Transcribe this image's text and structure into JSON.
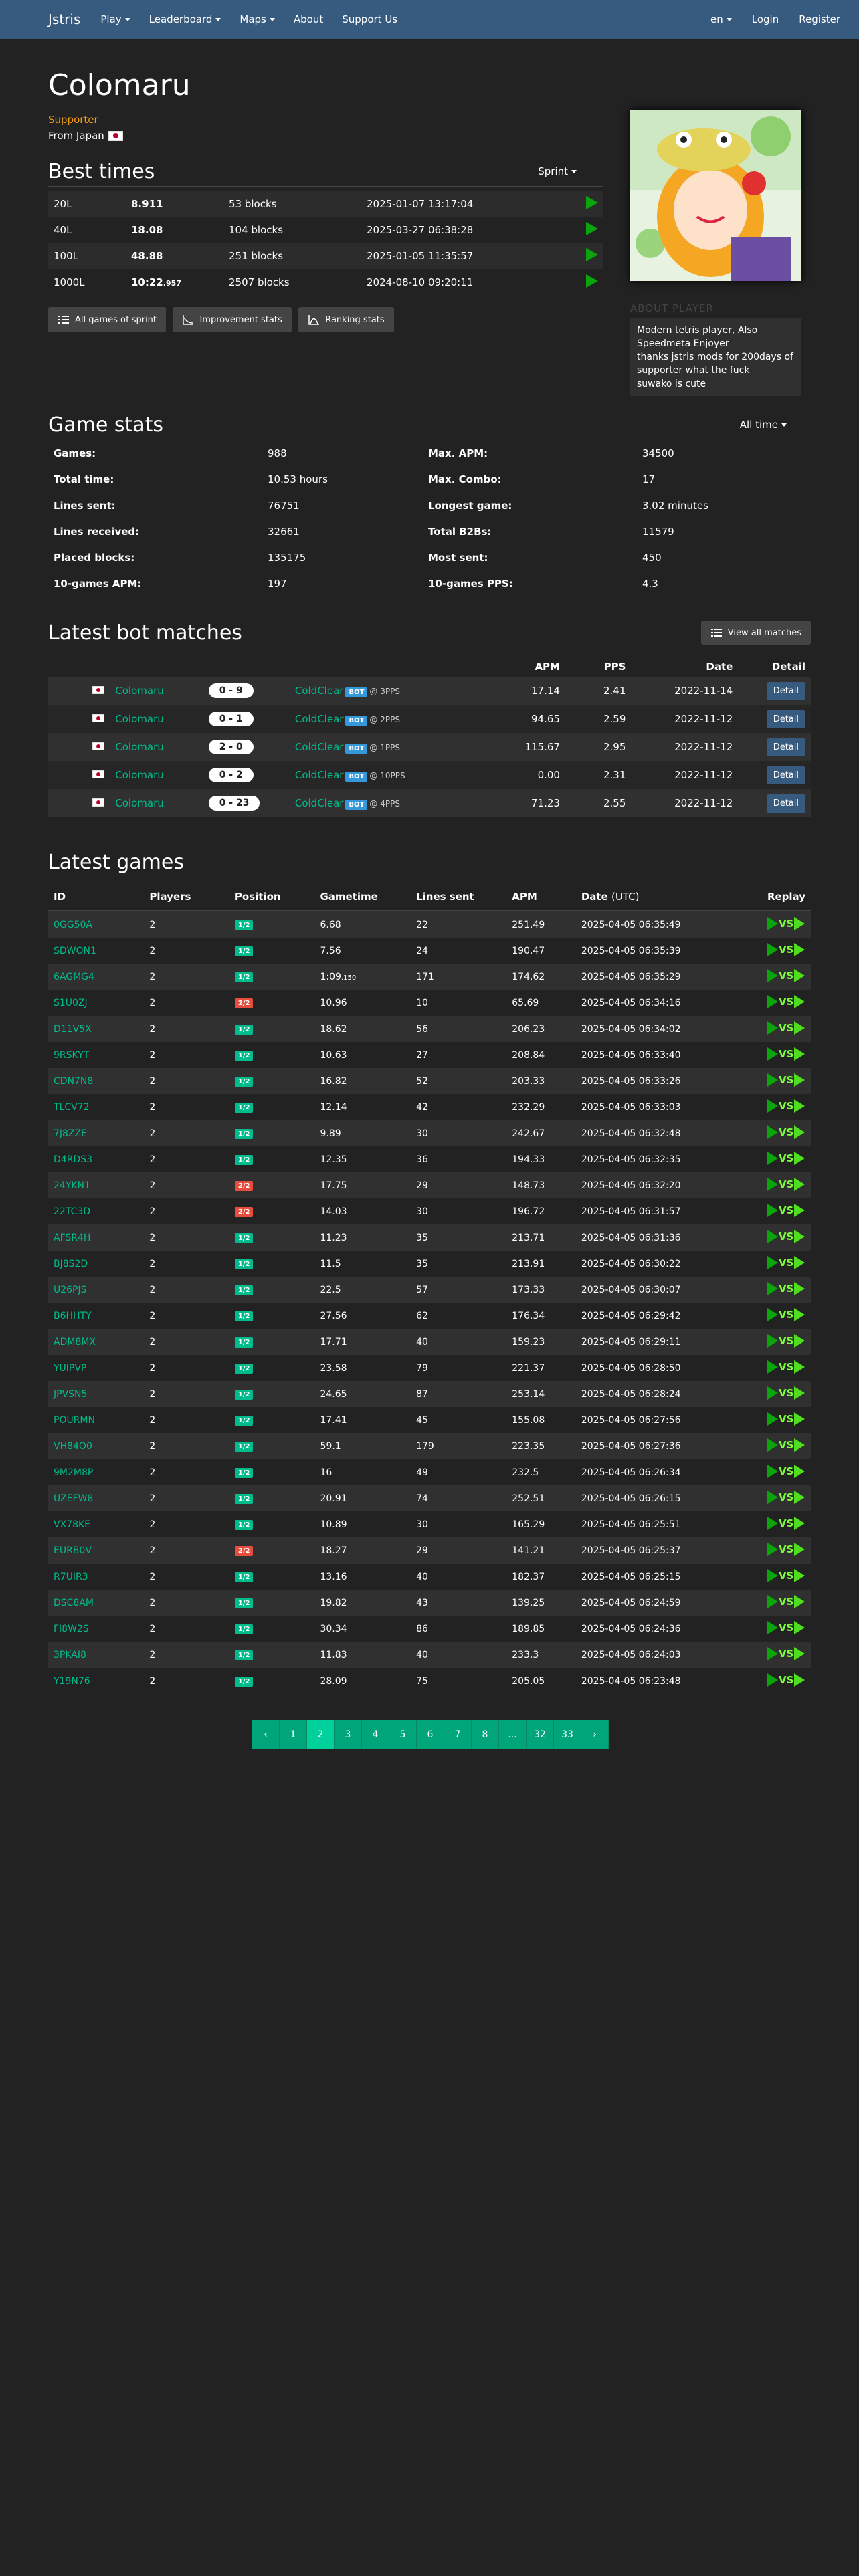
{
  "navbar": {
    "brand": "Jstris",
    "items": [
      "Play",
      "Leaderboard",
      "Maps",
      "About",
      "Support Us"
    ],
    "lang": "en",
    "login": "Login",
    "register": "Register"
  },
  "profile": {
    "username": "Colomaru",
    "role": "Supporter",
    "from": "From Japan",
    "about_label": "ABOUT PLAYER",
    "about_lines": [
      "Modern tetris player, Also Speedmeta Enjoyer",
      "thanks jstris mods for 200days of supporter what the fuck",
      "suwako is cute"
    ]
  },
  "best_times": {
    "title": "Best times",
    "dropdown": "Sprint",
    "rows": [
      {
        "mode": "20L",
        "time": "8.911",
        "blocks": "53 blocks",
        "date": "2025-01-07 13:17:04"
      },
      {
        "mode": "40L",
        "time": "18.08",
        "blocks": "104 blocks",
        "date": "2025-03-27 06:38:28"
      },
      {
        "mode": "100L",
        "time": "48.88",
        "blocks": "251 blocks",
        "date": "2025-01-05 11:35:57"
      },
      {
        "mode": "1000L",
        "time": "10:22",
        "time_ms": ".957",
        "blocks": "2507 blocks",
        "date": "2024-08-10 09:20:11"
      }
    ],
    "buttons": [
      "All games of sprint",
      "Improvement stats",
      "Ranking stats"
    ]
  },
  "game_stats": {
    "title": "Game stats",
    "dropdown": "All time",
    "rows": [
      [
        "Games:",
        "988",
        "Max. APM:",
        "34500"
      ],
      [
        "Total time:",
        "10.53 hours",
        "Max. Combo:",
        "17"
      ],
      [
        "Lines sent:",
        "76751",
        "Longest game:",
        "3.02 minutes"
      ],
      [
        "Lines received:",
        "32661",
        "Total B2Bs:",
        "11579"
      ],
      [
        "Placed blocks:",
        "135175",
        "Most sent:",
        "450"
      ],
      [
        "10-games APM:",
        "197",
        "10-games PPS:",
        "4.3"
      ]
    ]
  },
  "bot_matches": {
    "title": "Latest bot matches",
    "view_all": "View all matches",
    "headers": [
      "APM",
      "PPS",
      "Date",
      "Detail"
    ],
    "bot_badge": "BOT",
    "detail_label": "Detail",
    "rows": [
      {
        "player": "Colomaru",
        "score": "0 - 9",
        "bot": "ColdClear",
        "pps_setting": "@ 3PPS",
        "apm": "17.14",
        "pps": "2.41",
        "date": "2022-11-14"
      },
      {
        "player": "Colomaru",
        "score": "0 - 1",
        "bot": "ColdClear",
        "pps_setting": "@ 2PPS",
        "apm": "94.65",
        "pps": "2.59",
        "date": "2022-11-12"
      },
      {
        "player": "Colomaru",
        "score": "2 - 0",
        "bot": "ColdClear",
        "pps_setting": "@ 1PPS",
        "apm": "115.67",
        "pps": "2.95",
        "date": "2022-11-12"
      },
      {
        "player": "Colomaru",
        "score": "0 - 2",
        "bot": "ColdClear",
        "pps_setting": "@ 10PPS",
        "apm": "0.00",
        "pps": "2.31",
        "date": "2022-11-12"
      },
      {
        "player": "Colomaru",
        "score": "0 - 23",
        "bot": "ColdClear",
        "pps_setting": "@ 4PPS",
        "apm": "71.23",
        "pps": "2.55",
        "date": "2022-11-12"
      }
    ]
  },
  "latest_games": {
    "title": "Latest games",
    "headers": [
      "ID",
      "Players",
      "Position",
      "Gametime",
      "Lines sent",
      "APM",
      "Date",
      "(UTC)",
      "Replay"
    ],
    "rows": [
      {
        "id": "0GG50A",
        "players": "2",
        "pos": "1/2",
        "win": true,
        "time": "6.68",
        "lines": "22",
        "apm": "251.49",
        "date": "2025-04-05 06:35:49"
      },
      {
        "id": "SDWON1",
        "players": "2",
        "pos": "1/2",
        "win": true,
        "time": "7.56",
        "lines": "24",
        "apm": "190.47",
        "date": "2025-04-05 06:35:39"
      },
      {
        "id": "6AGMG4",
        "players": "2",
        "pos": "1/2",
        "win": true,
        "time": "1:09",
        "time_ms": ".150",
        "lines": "171",
        "apm": "174.62",
        "date": "2025-04-05 06:35:29"
      },
      {
        "id": "S1U0ZJ",
        "players": "2",
        "pos": "2/2",
        "win": false,
        "time": "10.96",
        "lines": "10",
        "apm": "65.69",
        "date": "2025-04-05 06:34:16"
      },
      {
        "id": "D11V5X",
        "players": "2",
        "pos": "1/2",
        "win": true,
        "time": "18.62",
        "lines": "56",
        "apm": "206.23",
        "date": "2025-04-05 06:34:02"
      },
      {
        "id": "9RSKYT",
        "players": "2",
        "pos": "1/2",
        "win": true,
        "time": "10.63",
        "lines": "27",
        "apm": "208.84",
        "date": "2025-04-05 06:33:40"
      },
      {
        "id": "CDN7N8",
        "players": "2",
        "pos": "1/2",
        "win": true,
        "time": "16.82",
        "lines": "52",
        "apm": "203.33",
        "date": "2025-04-05 06:33:26"
      },
      {
        "id": "TLCV72",
        "players": "2",
        "pos": "1/2",
        "win": true,
        "time": "12.14",
        "lines": "42",
        "apm": "232.29",
        "date": "2025-04-05 06:33:03"
      },
      {
        "id": "7J8ZZE",
        "players": "2",
        "pos": "1/2",
        "win": true,
        "time": "9.89",
        "lines": "30",
        "apm": "242.67",
        "date": "2025-04-05 06:32:48"
      },
      {
        "id": "D4RDS3",
        "players": "2",
        "pos": "1/2",
        "win": true,
        "time": "12.35",
        "lines": "36",
        "apm": "194.33",
        "date": "2025-04-05 06:32:35"
      },
      {
        "id": "24YKN1",
        "players": "2",
        "pos": "2/2",
        "win": false,
        "time": "17.75",
        "lines": "29",
        "apm": "148.73",
        "date": "2025-04-05 06:32:20"
      },
      {
        "id": "22TC3D",
        "players": "2",
        "pos": "2/2",
        "win": false,
        "time": "14.03",
        "lines": "30",
        "apm": "196.72",
        "date": "2025-04-05 06:31:57"
      },
      {
        "id": "AFSR4H",
        "players": "2",
        "pos": "1/2",
        "win": true,
        "time": "11.23",
        "lines": "35",
        "apm": "213.71",
        "date": "2025-04-05 06:31:36"
      },
      {
        "id": "BJ8S2D",
        "players": "2",
        "pos": "1/2",
        "win": true,
        "time": "11.5",
        "lines": "35",
        "apm": "213.91",
        "date": "2025-04-05 06:30:22"
      },
      {
        "id": "U26PJS",
        "players": "2",
        "pos": "1/2",
        "win": true,
        "time": "22.5",
        "lines": "57",
        "apm": "173.33",
        "date": "2025-04-05 06:30:07"
      },
      {
        "id": "B6HHTY",
        "players": "2",
        "pos": "1/2",
        "win": true,
        "time": "27.56",
        "lines": "62",
        "apm": "176.34",
        "date": "2025-04-05 06:29:42"
      },
      {
        "id": "ADM8MX",
        "players": "2",
        "pos": "1/2",
        "win": true,
        "time": "17.71",
        "lines": "40",
        "apm": "159.23",
        "date": "2025-04-05 06:29:11"
      },
      {
        "id": "YUIPVP",
        "players": "2",
        "pos": "1/2",
        "win": true,
        "time": "23.58",
        "lines": "79",
        "apm": "221.37",
        "date": "2025-04-05 06:28:50"
      },
      {
        "id": "JPVSN5",
        "players": "2",
        "pos": "1/2",
        "win": true,
        "time": "24.65",
        "lines": "87",
        "apm": "253.14",
        "date": "2025-04-05 06:28:24"
      },
      {
        "id": "POURMN",
        "players": "2",
        "pos": "1/2",
        "win": true,
        "time": "17.41",
        "lines": "45",
        "apm": "155.08",
        "date": "2025-04-05 06:27:56"
      },
      {
        "id": "VH84O0",
        "players": "2",
        "pos": "1/2",
        "win": true,
        "time": "59.1",
        "lines": "179",
        "apm": "223.35",
        "date": "2025-04-05 06:27:36"
      },
      {
        "id": "9M2M8P",
        "players": "2",
        "pos": "1/2",
        "win": true,
        "time": "16",
        "lines": "49",
        "apm": "232.5",
        "date": "2025-04-05 06:26:34"
      },
      {
        "id": "UZEFW8",
        "players": "2",
        "pos": "1/2",
        "win": true,
        "time": "20.91",
        "lines": "74",
        "apm": "252.51",
        "date": "2025-04-05 06:26:15"
      },
      {
        "id": "VX78KE",
        "players": "2",
        "pos": "1/2",
        "win": true,
        "time": "10.89",
        "lines": "30",
        "apm": "165.29",
        "date": "2025-04-05 06:25:51"
      },
      {
        "id": "EURB0V",
        "players": "2",
        "pos": "2/2",
        "win": false,
        "time": "18.27",
        "lines": "29",
        "apm": "141.21",
        "date": "2025-04-05 06:25:37"
      },
      {
        "id": "R7UIR3",
        "players": "2",
        "pos": "1/2",
        "win": true,
        "time": "13.16",
        "lines": "40",
        "apm": "182.37",
        "date": "2025-04-05 06:25:15"
      },
      {
        "id": "DSC8AM",
        "players": "2",
        "pos": "1/2",
        "win": true,
        "time": "19.82",
        "lines": "43",
        "apm": "139.25",
        "date": "2025-04-05 06:24:59"
      },
      {
        "id": "FI8W2S",
        "players": "2",
        "pos": "1/2",
        "win": true,
        "time": "30.34",
        "lines": "86",
        "apm": "189.85",
        "date": "2025-04-05 06:24:36"
      },
      {
        "id": "3PKAI8",
        "players": "2",
        "pos": "1/2",
        "win": true,
        "time": "11.83",
        "lines": "40",
        "apm": "233.3",
        "date": "2025-04-05 06:24:03"
      },
      {
        "id": "Y19N76",
        "players": "2",
        "pos": "1/2",
        "win": true,
        "time": "28.09",
        "lines": "75",
        "apm": "205.05",
        "date": "2025-04-05 06:23:48"
      }
    ],
    "vs_label": "VS"
  },
  "pagination": {
    "prev": "‹",
    "next": "›",
    "pages": [
      "1",
      "2",
      "3",
      "4",
      "5",
      "6",
      "7",
      "8",
      "...",
      "32",
      "33"
    ],
    "active": "2"
  },
  "colors": {
    "navbar": "#375a7f",
    "background": "#222222",
    "link": "#00bc8c",
    "supporter": "#f39c12",
    "win_badge": "#00bc8c",
    "lose_badge": "#e74c3c",
    "bot_badge": "#3498db"
  }
}
